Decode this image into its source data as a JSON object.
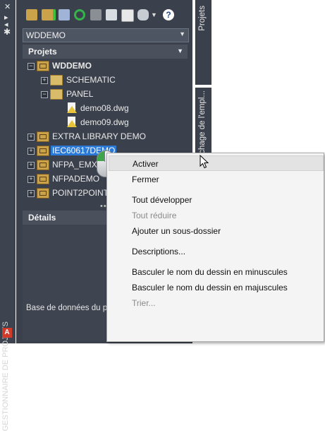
{
  "side_strip": {
    "close_label": "✕",
    "vertical_title": "GESTIONNAIRE DE PROJETS",
    "logo": "A"
  },
  "toolbar": {
    "icons": [
      "open-project-icon",
      "new-project-icon",
      "project-properties-icon",
      "refresh-icon",
      "drawing-list-icon",
      "update-icon",
      "publish-icon",
      "plot-icon",
      "help-icon"
    ]
  },
  "project_select": {
    "value": "WDDEMO"
  },
  "projects_section": {
    "title": "Projets"
  },
  "tree": {
    "items": [
      {
        "label": "WDDEMO",
        "level": 0,
        "kind": "project",
        "expanded": true,
        "bold": true
      },
      {
        "label": "SCHEMATIC",
        "level": 1,
        "kind": "folder",
        "expanded": false
      },
      {
        "label": "PANEL",
        "level": 1,
        "kind": "folder",
        "expanded": true
      },
      {
        "label": "demo08.dwg",
        "level": 2,
        "kind": "drawing"
      },
      {
        "label": "demo09.dwg",
        "level": 2,
        "kind": "drawing"
      },
      {
        "label": "EXTRA LIBRARY DEMO",
        "level": 0,
        "kind": "project",
        "expanded": false
      },
      {
        "label": "IEC60617DEMO",
        "level": 0,
        "kind": "project",
        "expanded": false,
        "selected": true
      },
      {
        "label": "NFPA_EMXDEMO",
        "level": 0,
        "kind": "project",
        "expanded": false
      },
      {
        "label": "NFPADEMO",
        "level": 0,
        "kind": "project",
        "expanded": false
      },
      {
        "label": "POINT2POINT",
        "level": 0,
        "kind": "project",
        "expanded": false
      }
    ]
  },
  "details_section": {
    "title": "Détails",
    "status": "Base de données du p"
  },
  "side_tabs": {
    "tab1": "Projets",
    "tab2": "chage de l'empl..."
  },
  "context_menu": {
    "items": [
      {
        "label": "Activer",
        "highlighted": true
      },
      {
        "label": "Fermer"
      },
      {
        "label": "Tout développer"
      },
      {
        "label": "Tout réduire",
        "disabled": true
      },
      {
        "label": "Ajouter un sous-dossier"
      },
      {
        "label": "Descriptions..."
      },
      {
        "label": "Basculer le nom du dessin en minuscules"
      },
      {
        "label": "Basculer le nom du dessin en majuscules"
      },
      {
        "label": "Trier...",
        "disabled": true
      }
    ]
  },
  "colors": {
    "panel": "#3b414c",
    "selection": "#2b79d6",
    "menu_bg": "#f4f4f4"
  }
}
